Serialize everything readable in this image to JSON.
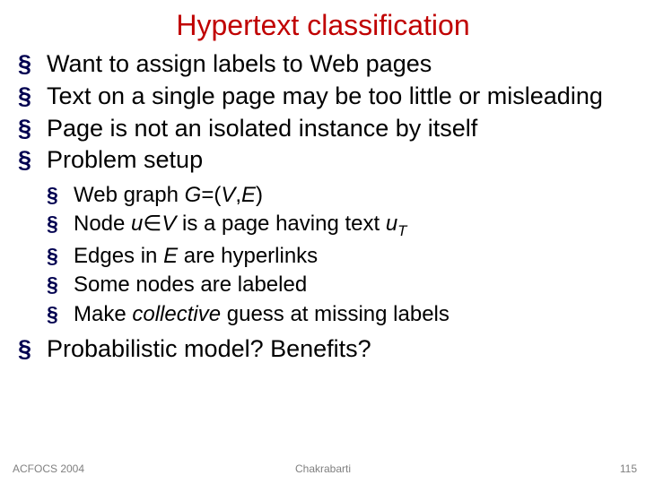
{
  "title": "Hypertext classification",
  "bullets": {
    "b1": "Want to assign labels to Web pages",
    "b2": "Text on a single page may be too little or misleading",
    "b3": "Page is not an isolated instance by itself",
    "b4": "Problem setup",
    "b5": "Probabilistic model? Benefits?"
  },
  "sub": {
    "s1a": "Web graph ",
    "s1b": "G",
    "s1c": "=(",
    "s1d": "V",
    "s1e": ",",
    "s1f": "E",
    "s1g": ")",
    "s2a": "Node ",
    "s2b": "u",
    "s2c": "∈",
    "s2d": "V",
    "s2e": " is a page having text ",
    "s2f": "u",
    "s2g": "T",
    "s3a": "Edges in ",
    "s3b": "E",
    "s3c": " are hyperlinks",
    "s4": "Some nodes are labeled",
    "s5a": "Make ",
    "s5b": "collective",
    "s5c": " guess at missing labels"
  },
  "footer": {
    "left": "ACFOCS 2004",
    "center": "Chakrabarti",
    "right": "115"
  }
}
